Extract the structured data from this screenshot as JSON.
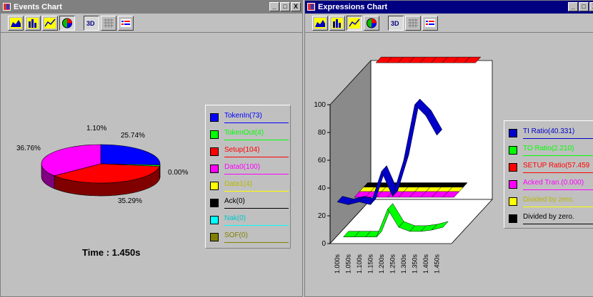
{
  "events_window": {
    "title": "Events Chart",
    "controls": [
      "_",
      "□",
      "X"
    ],
    "toolbar": [
      "area-chart-icon",
      "bar-chart-icon",
      "line-chart-icon",
      "pie-chart-icon",
      "3d-icon",
      "grid-icon",
      "series-icon"
    ],
    "time_label": "Time : 1.450s"
  },
  "expressions_window": {
    "title": "Expressions Chart",
    "controls": [
      "_",
      "□",
      "X"
    ],
    "toolbar": [
      "area-chart-icon",
      "bar-chart-icon",
      "line-chart-icon",
      "pie-chart-icon",
      "3d-icon",
      "grid-icon",
      "series-icon"
    ]
  },
  "chart_data": [
    {
      "type": "pie",
      "title": "",
      "slices": [
        {
          "name": "TokenIn(73)",
          "value": 25.74,
          "label": "25.74%",
          "color": "#0000ff"
        },
        {
          "name": "TokenOut(4)",
          "value": 1.1,
          "label": "1.10%",
          "color": "#00ff00"
        },
        {
          "name": "Setup(104)",
          "value": 36.76,
          "label": "36.76%",
          "color": "#ff0000"
        },
        {
          "name": "Data0(100)",
          "value": 35.29,
          "label": "35.29%",
          "color": "#ff00ff"
        },
        {
          "name": "Data1(4)",
          "value": 0.0,
          "label": "0.00%",
          "color": "#ffff00"
        },
        {
          "name": "Ack(0)",
          "value": 0,
          "label": "",
          "color": "#000000"
        },
        {
          "name": "Nak(0)",
          "value": 0,
          "label": "",
          "color": "#00ffff"
        },
        {
          "name": "SOF(0)",
          "value": 0,
          "label": "",
          "color": "#808000"
        }
      ]
    },
    {
      "type": "line",
      "title": "",
      "y_ticks": [
        "100",
        "80",
        "60",
        "40",
        "20",
        "0"
      ],
      "ylim": [
        0,
        100
      ],
      "categories": [
        "1.000s",
        "1.050s",
        "1.100s",
        "1.150s",
        "1.200s",
        "1.250s",
        "1.300s",
        "1.350s",
        "1.400s",
        "1.450s"
      ],
      "series": [
        {
          "name": "TI Ratio(40.331)",
          "color": "#0000c8",
          "values": [
            30,
            28,
            30,
            28,
            52,
            34,
            60,
            100,
            92,
            78
          ]
        },
        {
          "name": "TO Ratio(2.210)",
          "color": "#00ff00",
          "values": [
            0,
            0,
            0,
            0,
            20,
            7,
            4,
            4,
            5,
            7
          ]
        },
        {
          "name": "SETUP Ratio(57.459",
          "color": "#ff0000",
          "values": [
            100,
            100,
            100,
            100,
            100,
            100,
            100,
            100,
            100,
            100
          ]
        },
        {
          "name": "Acked Tran.(0.000)",
          "color": "#ff00ff",
          "values": [
            20,
            20,
            20,
            20,
            20,
            20,
            20,
            20,
            20,
            20
          ]
        },
        {
          "name": "Divided by zero.",
          "color": "#ffff00",
          "values": [
            20,
            20,
            20,
            20,
            20,
            20,
            20,
            20,
            20,
            20
          ]
        },
        {
          "name": "Divided by zero.",
          "color": "#000000",
          "values": [
            20,
            20,
            20,
            20,
            20,
            20,
            20,
            20,
            20,
            20
          ]
        }
      ]
    }
  ]
}
